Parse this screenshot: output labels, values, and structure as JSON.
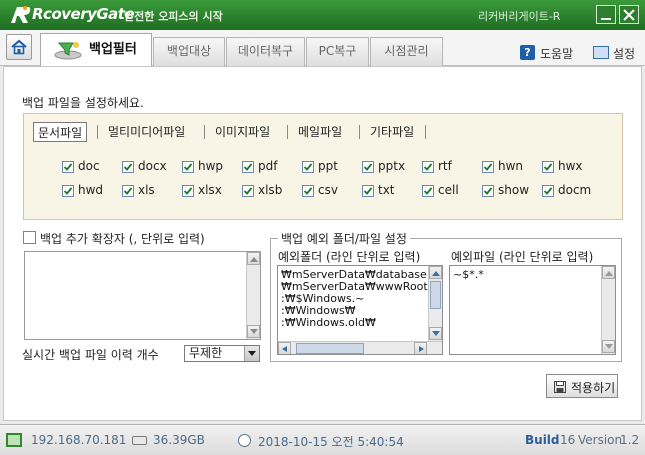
{
  "window": {
    "logo_text": "RcoveryGate",
    "logo_sub": "안전한 오피스의 시작",
    "title_right": "리커버리게이트-R"
  },
  "tabs": [
    {
      "label": "백업필터",
      "active": true
    },
    {
      "label": "백업대상"
    },
    {
      "label": "데이터복구"
    },
    {
      "label": "PC복구"
    },
    {
      "label": "시점관리"
    }
  ],
  "toolbar": {
    "help_label": "도움말",
    "setup_label": "설정",
    "help_icon": "?"
  },
  "backup_filter": {
    "heading": "백업 파일을 설정하세요.",
    "categories": [
      "문서파일",
      "멀티미디어파일",
      "이미지파일",
      "메일파일",
      "기타파일"
    ],
    "active_category": "문서파일",
    "extensions": [
      {
        "label": "doc",
        "checked": true
      },
      {
        "label": "docx",
        "checked": true
      },
      {
        "label": "hwp",
        "checked": true
      },
      {
        "label": "pdf",
        "checked": true
      },
      {
        "label": "ppt",
        "checked": true
      },
      {
        "label": "pptx",
        "checked": true
      },
      {
        "label": "rtf",
        "checked": true
      },
      {
        "label": "hwn",
        "checked": true
      },
      {
        "label": "hwx",
        "checked": true
      },
      {
        "label": "hwd",
        "checked": true
      },
      {
        "label": "xls",
        "checked": true
      },
      {
        "label": "xlsx",
        "checked": true
      },
      {
        "label": "xlsb",
        "checked": true
      },
      {
        "label": "csv",
        "checked": true
      },
      {
        "label": "txt",
        "checked": true
      },
      {
        "label": "cell",
        "checked": true
      },
      {
        "label": "show",
        "checked": true
      },
      {
        "label": "docm",
        "checked": true
      }
    ],
    "additional_ext_label": "백업 추가 확장자 (, 단위로 입력)",
    "additional_ext_checked": false,
    "additional_ext_value": "",
    "history_label": "실시간 백업 파일 이력 개수",
    "history_value": "무제한"
  },
  "exclusion": {
    "group_title": "백업 예외 폴더/파일 설정",
    "folder_label": "예외폴더 (라인 단위로 입력)",
    "file_label": "예외파일 (라인 단위로 입력)",
    "folders": [
      "₩mServerData₩database",
      "₩mServerData₩wwwRoot",
      ":₩$Windows.~",
      ":₩Windows₩",
      ":₩Windows.old₩"
    ],
    "files": [
      "~$*.*"
    ]
  },
  "apply_label": "적용하기",
  "status": {
    "ip": "192.168.70.181",
    "disk": "36.39GB",
    "datetime": "2018-10-15 오전 5:40:54",
    "build_label": "Build",
    "build_number": "16",
    "version_label": "Version",
    "version_number": "1.2"
  },
  "colors": {
    "title_green": "#2a8a2c",
    "accent_blue": "#2b5f97",
    "filter_bg": "#f8f5e6"
  }
}
